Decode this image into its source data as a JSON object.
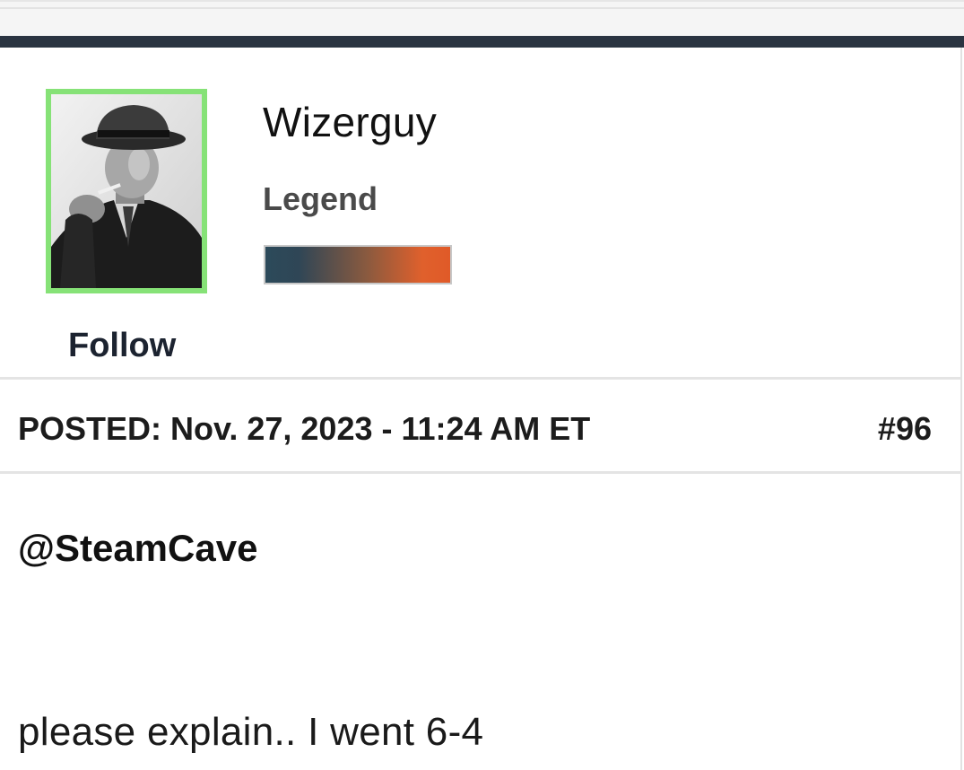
{
  "post": {
    "author": {
      "username": "Wizerguy",
      "rank": "Legend",
      "follow_label": "Follow",
      "avatar_border_color": "#86e277",
      "rank_bar_colors": [
        "#2c4a5a",
        "#e0602c"
      ]
    },
    "meta": {
      "posted_label": "POSTED:",
      "posted_datetime": "Nov. 27, 2023 - 11:24 AM ET",
      "post_number": "#96"
    },
    "body": {
      "mention": "@SteamCave",
      "text": "please explain.. I went 6-4"
    }
  },
  "colors": {
    "header_bar": "#2a3441",
    "divider": "#e4e4e4"
  }
}
